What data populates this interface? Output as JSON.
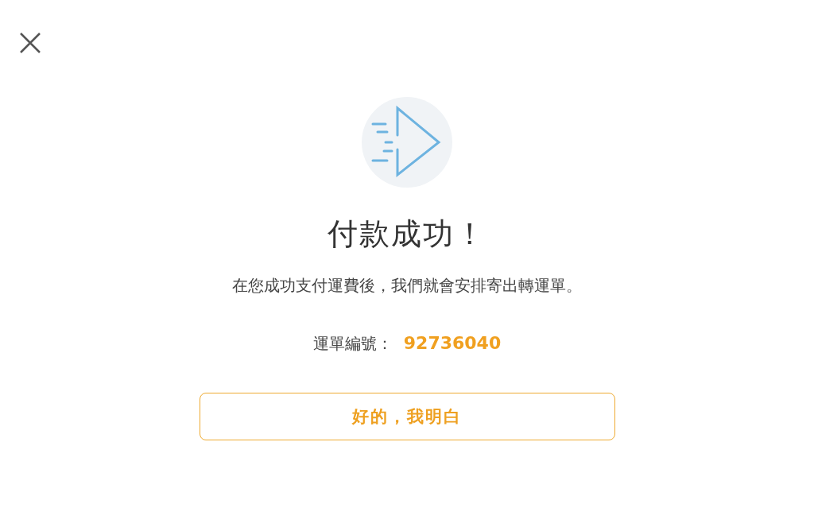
{
  "title": "付款成功！",
  "message": "在您成功支付運費後，我們就會安排寄出轉運單。",
  "tracking": {
    "label": "運單編號：",
    "value": "92736040"
  },
  "button": "好的，我明白"
}
